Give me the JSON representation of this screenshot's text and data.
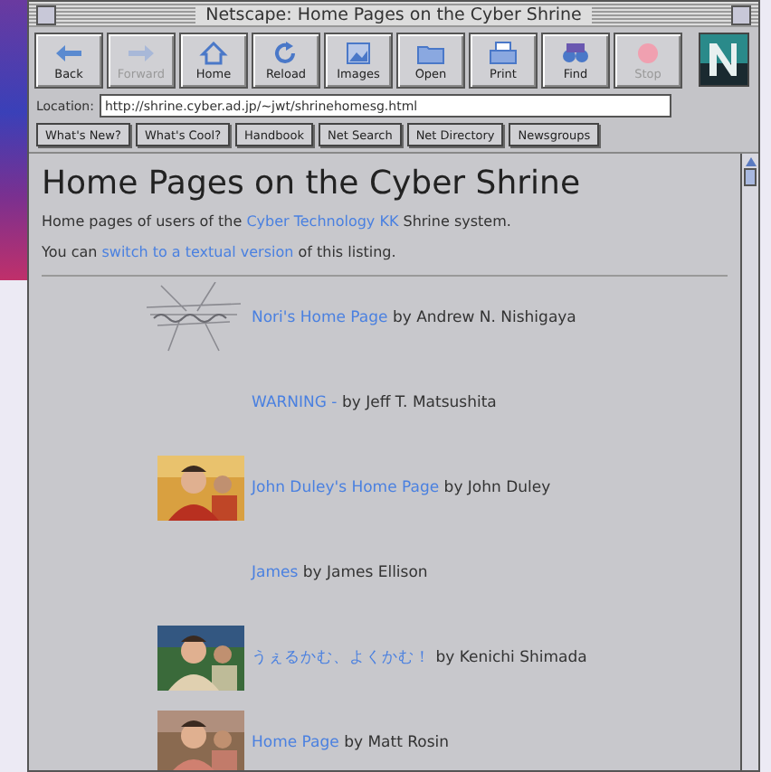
{
  "window": {
    "title": "Netscape: Home Pages on the Cyber Shrine"
  },
  "toolbar": {
    "buttons": [
      {
        "label": "Back",
        "kind": "back",
        "disabled": false
      },
      {
        "label": "Forward",
        "kind": "forward",
        "disabled": true
      },
      {
        "label": "Home",
        "kind": "home",
        "disabled": false
      },
      {
        "label": "Reload",
        "kind": "reload",
        "disabled": false
      },
      {
        "label": "Images",
        "kind": "images",
        "disabled": false
      },
      {
        "label": "Open",
        "kind": "open",
        "disabled": false
      },
      {
        "label": "Print",
        "kind": "print",
        "disabled": false
      },
      {
        "label": "Find",
        "kind": "find",
        "disabled": false
      },
      {
        "label": "Stop",
        "kind": "stop",
        "disabled": true
      }
    ]
  },
  "location": {
    "label": "Location:",
    "value": "http://shrine.cyber.ad.jp/~jwt/shrinehomesg.html"
  },
  "directory_buttons": [
    "What's New?",
    "What's Cool?",
    "Handbook",
    "Net Search",
    "Net Directory",
    "Newsgroups"
  ],
  "page": {
    "heading": "Home Pages on the Cyber Shrine",
    "intro": {
      "before": "Home pages of users of the",
      "link": "Cyber Technology KK",
      "after": "Shrine system."
    },
    "note": {
      "before": "You can",
      "link": "switch to a textual version",
      "after": "of this listing."
    },
    "entries": [
      {
        "kind": "sketch",
        "link": "Nori's Home Page",
        "byline": "by Andrew N. Nishigaya"
      },
      {
        "kind": "none",
        "link": "WARNING -",
        "byline": "by Jeff T. Matsushita"
      },
      {
        "link": "John Duley's Home Page",
        "byline": "by John Duley"
      },
      {
        "kind": "none",
        "link": "James",
        "byline": "by James Ellison"
      },
      {
        "link": "うぇるかむ、よくかむ！",
        "byline": "by Kenichi Shimada"
      },
      {
        "link": "Home Page",
        "byline": "by Matt Rosin"
      }
    ]
  }
}
